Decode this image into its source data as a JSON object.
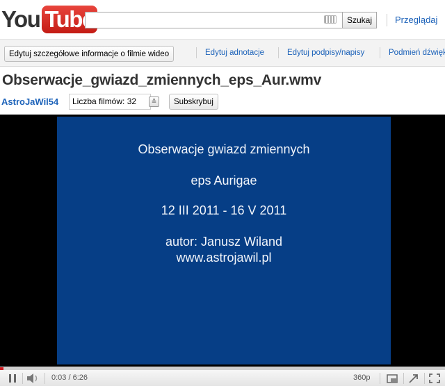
{
  "header": {
    "logo_you": "You",
    "logo_tube": "Tube",
    "search_value": "",
    "search_button": "Szukaj",
    "browse_link": "Przeglądaj"
  },
  "toolbar": {
    "edit_info_button": "Edytuj szczegółowe informacje o filmie wideo",
    "edit_annotations": "Edytuj adnotacje",
    "edit_captions": "Edytuj podpisy/napisy",
    "replace_audio": "Podmień dźwięk"
  },
  "video": {
    "title": "Obserwacje_gwiazd_zmiennych_eps_Aur.wmv",
    "channel": "AstroJaWil54",
    "video_count": "Liczba filmów: 32",
    "subscribe": "Subskrybuj",
    "frame_lines": [
      "Obserwacje gwiazd zmiennych",
      "eps Aurigae",
      "12 III 2011 - 16 V 2011",
      "autor: Janusz Wiland",
      "www.astrojawil.pl"
    ]
  },
  "controls": {
    "time": "0:03 / 6:26",
    "quality": "360p",
    "progress_fraction": 0.008
  },
  "colors": {
    "link": "#1c62b9",
    "frame_bg": "#063e86",
    "logo_red": "#d8261f",
    "progress_red": "#cc181e"
  },
  "icons": [
    "keyboard-icon",
    "chevron-down-icon",
    "pause-icon",
    "volume-icon",
    "popout-icon",
    "expand-icon",
    "fullscreen-icon"
  ]
}
